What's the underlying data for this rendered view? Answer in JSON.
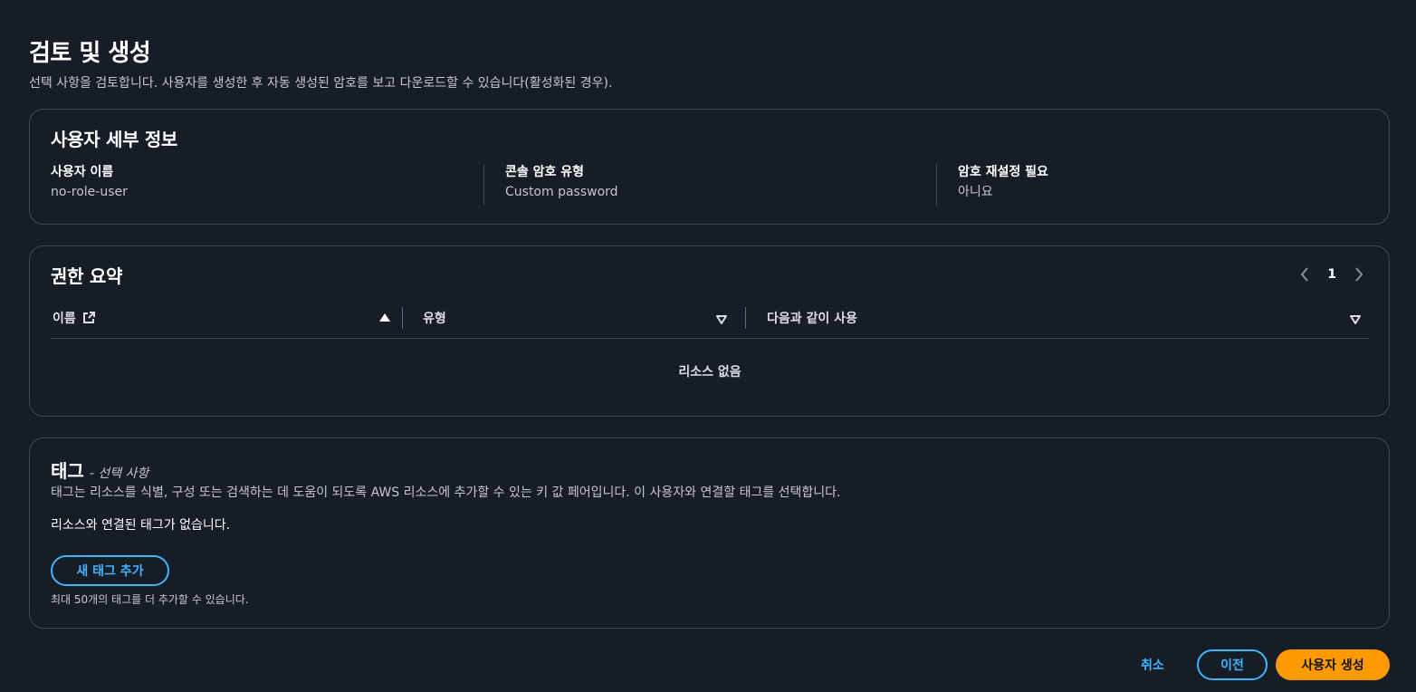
{
  "header": {
    "title": "검토 및 생성",
    "description": "선택 사항을 검토합니다. 사용자를 생성한 후 자동 생성된 암호를 보고 다운로드할 수 있습니다(활성화된 경우)."
  },
  "user_details": {
    "title": "사용자 세부 정보",
    "fields": [
      {
        "label": "사용자 이름",
        "value": "no-role-user"
      },
      {
        "label": "콘솔 암호 유형",
        "value": "Custom password"
      },
      {
        "label": "암호 재설정 필요",
        "value": "아니요"
      }
    ]
  },
  "permissions": {
    "title": "권한 요약",
    "page": "1",
    "columns": [
      "이름",
      "유형",
      "다음과 같이 사용"
    ],
    "empty_message": "리소스 없음"
  },
  "tags": {
    "title": "태그",
    "optional": "- 선택 사항",
    "description": "태그는 리소스를 식별, 구성 또는 검색하는 데 도움이 되도록 AWS 리소스에 추가할 수 있는 키 값 페어입니다. 이 사용자와 연결할 태그를 선택합니다.",
    "none_message": "리소스와 연결된 태그가 없습니다.",
    "add_button": "새 태그 추가",
    "limit_text": "최대 50개의 태그를 더 추가할 수 있습니다."
  },
  "footer": {
    "cancel": "취소",
    "previous": "이전",
    "create": "사용자 생성"
  },
  "colors": {
    "background": "#161d26",
    "border": "#424650",
    "link": "#42b4ff",
    "primary": "#ff9900"
  }
}
